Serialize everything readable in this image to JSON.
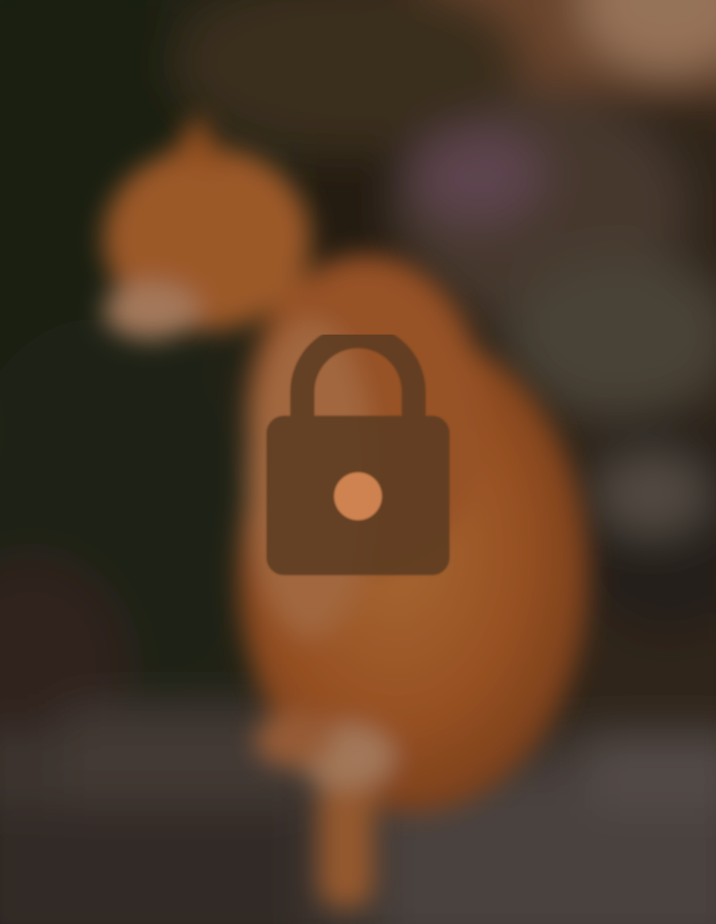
{
  "media": {
    "state": "locked",
    "blurred": true
  },
  "lock": {
    "icon": "lock-icon"
  },
  "colors": {
    "lock_body": "#5e3c22",
    "lock_keyhole": "#d38653",
    "cat_orange": "#d0702f",
    "foliage_dark": "#2a2a1e",
    "wall_gray": "#5d5655",
    "background": "#1b1712"
  }
}
